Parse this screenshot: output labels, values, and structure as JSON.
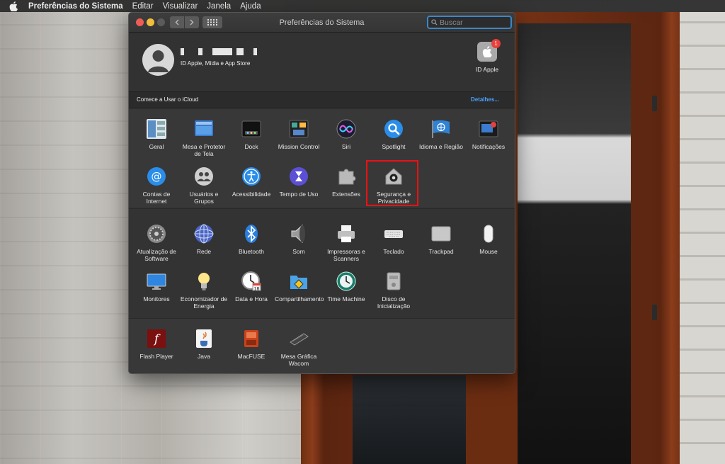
{
  "menubar": {
    "app_name": "Preferências do Sistema",
    "items": [
      "Editar",
      "Visualizar",
      "Janela",
      "Ajuda"
    ]
  },
  "window": {
    "title": "Preferências do Sistema",
    "search_placeholder": "Buscar"
  },
  "account": {
    "subtitle": "ID Apple, Mídia e App Store",
    "apple_id_label": "ID Apple",
    "badge_count": "1"
  },
  "icloud": {
    "prompt": "Comece a Usar o iCloud",
    "details_link": "Detalhes..."
  },
  "sections": {
    "row1": [
      {
        "label": "Geral",
        "icon": "general-icon"
      },
      {
        "label": "Mesa e Protetor de Tela",
        "icon": "desktop-icon"
      },
      {
        "label": "Dock",
        "icon": "dock-icon"
      },
      {
        "label": "Mission Control",
        "icon": "mission-control-icon"
      },
      {
        "label": "Siri",
        "icon": "siri-icon"
      },
      {
        "label": "Spotlight",
        "icon": "spotlight-icon"
      },
      {
        "label": "Idioma e Região",
        "icon": "language-icon"
      },
      {
        "label": "Notificações",
        "icon": "notifications-icon"
      }
    ],
    "row2": [
      {
        "label": "Contas de Internet",
        "icon": "internet-accounts-icon"
      },
      {
        "label": "Usuários e Grupos",
        "icon": "users-icon"
      },
      {
        "label": "Acessibilidade",
        "icon": "accessibility-icon"
      },
      {
        "label": "Tempo de Uso",
        "icon": "screen-time-icon"
      },
      {
        "label": "Extensões",
        "icon": "extensions-icon"
      },
      {
        "label": "Segurança e Privacidade",
        "icon": "security-icon"
      }
    ],
    "row3": [
      {
        "label": "Atualização de Software",
        "icon": "software-update-icon"
      },
      {
        "label": "Rede",
        "icon": "network-icon"
      },
      {
        "label": "Bluetooth",
        "icon": "bluetooth-icon"
      },
      {
        "label": "Som",
        "icon": "sound-icon"
      },
      {
        "label": "Impressoras e Scanners",
        "icon": "printer-icon"
      },
      {
        "label": "Teclado",
        "icon": "keyboard-icon"
      },
      {
        "label": "Trackpad",
        "icon": "trackpad-icon"
      },
      {
        "label": "Mouse",
        "icon": "mouse-icon"
      }
    ],
    "row4": [
      {
        "label": "Monitores",
        "icon": "displays-icon"
      },
      {
        "label": "Economizador de Energia",
        "icon": "energy-icon"
      },
      {
        "label": "Data e Hora",
        "icon": "date-time-icon"
      },
      {
        "label": "Compartilhamento",
        "icon": "sharing-icon"
      },
      {
        "label": "Time Machine",
        "icon": "time-machine-icon"
      },
      {
        "label": "Disco de Inicialização",
        "icon": "startup-disk-icon"
      }
    ],
    "row5": [
      {
        "label": "Flash Player",
        "icon": "flash-icon"
      },
      {
        "label": "Java",
        "icon": "java-icon"
      },
      {
        "label": "MacFUSE",
        "icon": "macfuse-icon"
      },
      {
        "label": "Mesa Gráfica Wacom",
        "icon": "wacom-icon"
      }
    ]
  },
  "colors": {
    "highlight": "#e11111",
    "link": "#4aa3ff",
    "window_bg": "#323232"
  }
}
